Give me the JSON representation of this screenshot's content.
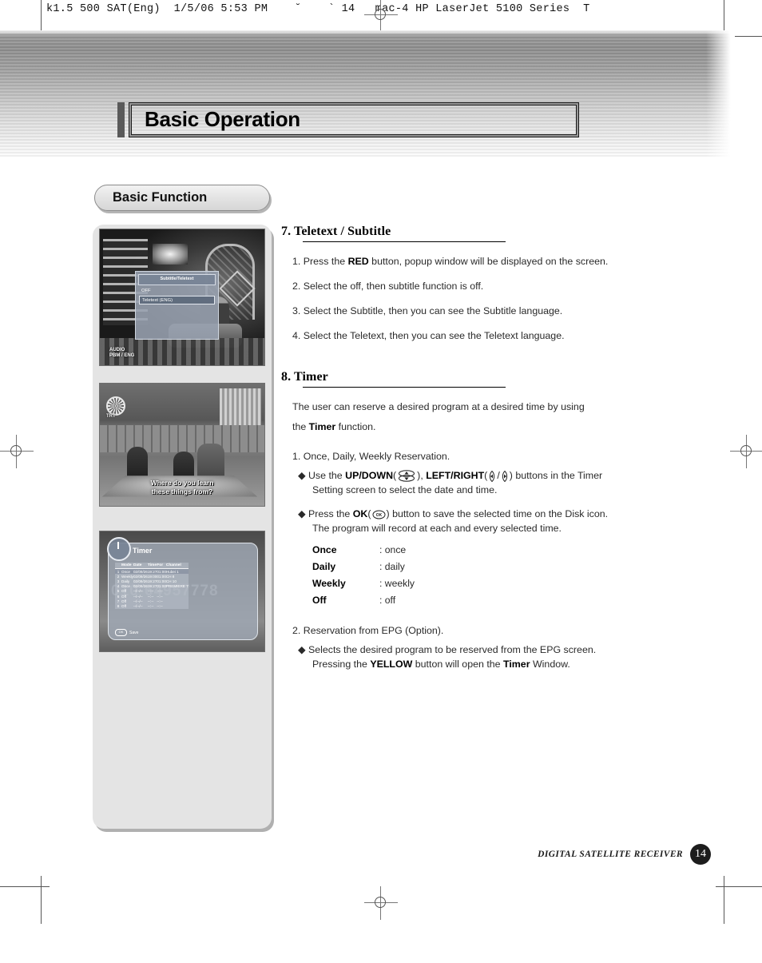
{
  "print_slug": "k1.5 500 SAT(Eng)  1/5/06 5:53 PM    ˘    ` 14   mac-4 HP LaserJet 5100 Series  T",
  "header": {
    "chapter_title": "Basic Operation",
    "section_pill": "Basic Function"
  },
  "sections": [
    {
      "number": "7.",
      "title": "Teletext / Subtitle",
      "items": [
        "1. Press the RED button, popup window will be displayed on the screen.",
        "2. Select the off, then subtitle function is off.",
        "3. Select the Subtitle, then you can see the Subtitle language.",
        "4. Select the Teletext, then you can see the Teletext language."
      ]
    },
    {
      "number": "8.",
      "title": "Timer"
    }
  ],
  "teletext": {
    "item1_pre": "1. Press the ",
    "item1_bold": "RED",
    "item1_post": " button, popup window will be displayed on the screen.",
    "item2": "2. Select the off, then subtitle function is off.",
    "item3": "3. Select the Subtitle, then you can see the Subtitle language.",
    "item4": "4. Select the Teletext, then you can see the Teletext language."
  },
  "timer": {
    "intro_line1": "The user can reserve a desired program at a desired time by using",
    "intro_line2_pre": "the ",
    "intro_line2_bold": "Timer",
    "intro_line2_post": " function.",
    "step1": "1. Once, Daily, Weekly Reservation.",
    "b1_pre": "Use the ",
    "b1_updown": "UP/DOWN",
    "b1_mid": ", ",
    "b1_leftright": "LEFT/RIGHT",
    "b1_post": ") buttons in the Timer",
    "b1_cont": "Setting screen to select the date and time.",
    "b2_pre": "Press the ",
    "b2_ok": "OK",
    "b2_post": ") button to save the selected time on the Disk icon.",
    "b2_cont": "The program will record at each and every selected time.",
    "definitions": [
      {
        "key": "Once",
        "value": ": once"
      },
      {
        "key": "Daily",
        "value": ": daily"
      },
      {
        "key": "Weekly",
        "value": ": weekly"
      },
      {
        "key": "Off",
        "value": ": off"
      }
    ],
    "step2": "2. Reservation from EPG (Option).",
    "b3": "Selects the desired program to be reserved from the EPG screen.",
    "b3_cont_pre": "Pressing the ",
    "b3_cont_yellow": "YELLOW",
    "b3_cont_mid": " button will open the ",
    "b3_cont_timer": "Timer",
    "b3_cont_post": " Window."
  },
  "screenshots": {
    "shot1": {
      "caption_semantic": "subtitle-teletext-popup",
      "popup_title": "Subtitle/Teletext",
      "options": [
        "OFF",
        "Teletext (ENG)"
      ],
      "selected_option": "Teletext (ENG)",
      "osd_badge": "AUDIO\nPBM / ENG"
    },
    "shot2": {
      "caption_semantic": "subtitle-display-example",
      "channel_label": "TRT",
      "subtitle_line1": "Where do you learn",
      "subtitle_line2": "these things from?"
    },
    "shot3": {
      "caption_semantic": "timer-reservation-screen",
      "title": "Timer",
      "background_text": "010-64957778",
      "columns": [
        "",
        "Mode",
        "Date",
        "Time",
        "For",
        "Channel"
      ],
      "rows": [
        [
          "1",
          "Once",
          "02/09/26",
          "19:27",
          "01:00",
          "Hubei 1"
        ],
        [
          "2",
          "Weekly",
          "02/09/26",
          "19:00",
          "01:00",
          "CH 8"
        ],
        [
          "3",
          "Daily",
          "02/09/26",
          "19:27",
          "01:00",
          "CH 10"
        ],
        [
          "4",
          "Once",
          "02/09/26",
          "19:27",
          "01:00",
          "PREMIERE 7"
        ],
        [
          "5",
          "Off",
          "--/--/--",
          "--:--",
          "--:--",
          ""
        ],
        [
          "6",
          "Off",
          "--/--/--",
          "--:--",
          "--:--",
          ""
        ],
        [
          "7",
          "Off",
          "--/--/--",
          "--:--",
          "--:--",
          ""
        ],
        [
          "8",
          "Off",
          "--/--/--",
          "--:--",
          "--:--",
          ""
        ]
      ],
      "save_key": "OK",
      "save_label": "Save"
    }
  },
  "footer": {
    "label": "DIGITAL SATELLITE RECEIVER",
    "page": "14"
  },
  "icons": {
    "updown": "up-down-rocker-icon",
    "left": "left-arrow-key-icon",
    "right": "right-arrow-key-icon",
    "ok": "ok-button-icon"
  }
}
